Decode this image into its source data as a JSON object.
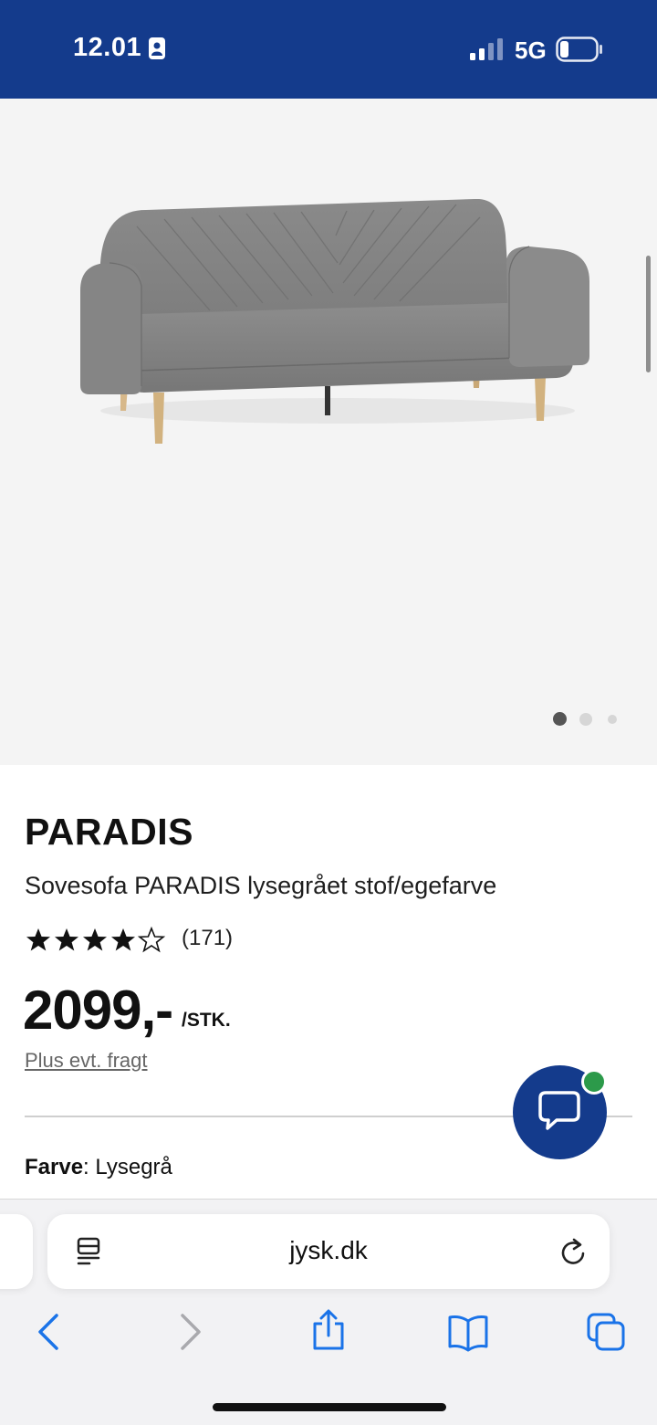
{
  "status_bar": {
    "time": "12.01",
    "network": "5G",
    "icons": [
      "contact-card-icon",
      "signal-icon",
      "battery-icon"
    ],
    "background_color": "#143b8c"
  },
  "gallery": {
    "image": "grey-sofa-bed-photo",
    "image_count": 3,
    "active_index": 0
  },
  "product": {
    "name": "PARADIS",
    "description": "Sovesofa PARADIS lysegrået stof/egefarve",
    "rating": 4,
    "rating_max": 5,
    "review_count": "(171)",
    "price": "2099,-",
    "price_unit": "/STK.",
    "shipping_note": "Plus evt. fragt",
    "color_key": "Farve",
    "color_value": ": Lysegrå"
  },
  "chat": {
    "icon": "chat-bubble-icon",
    "online_color": "#2c9a4a",
    "button_color": "#143b8c"
  },
  "browser": {
    "url": "jysk.dk",
    "icons": [
      "reader-icon",
      "reload-icon",
      "back-icon",
      "forward-icon",
      "share-icon",
      "bookmarks-icon",
      "tabs-icon"
    ],
    "accent_color": "#1a73e8"
  }
}
